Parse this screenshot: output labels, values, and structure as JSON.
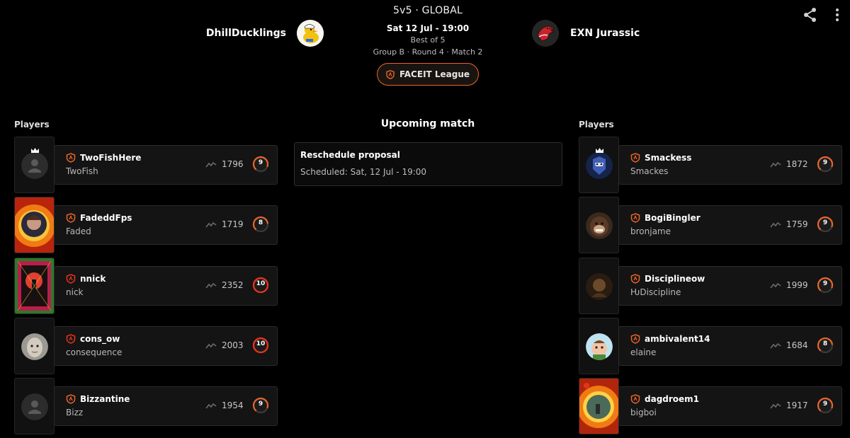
{
  "match": {
    "mode": "5v5 · GLOBAL",
    "datetime": "Sat 12 Jul - 19:00",
    "best_of": "Best of 5",
    "group_info": "Group B · Round 4 · Match 2",
    "league_label": "FACEIT League"
  },
  "team_left": {
    "name": "DhillDucklings",
    "players_label": "Players"
  },
  "team_right": {
    "name": "EXN Jurassic",
    "players_label": "Players"
  },
  "center": {
    "title": "Upcoming match",
    "proposal_title": "Reschedule proposal",
    "proposal_scheduled": "Scheduled: Sat, 12 Jul - 19:00"
  },
  "players_left": [
    {
      "nickname": "TwoFishHere",
      "name": "TwoFish",
      "elo": "1796",
      "level": "9",
      "captain": true,
      "avatar": "default-avatar"
    },
    {
      "nickname": "FadeddFps",
      "name": "Faded",
      "elo": "1719",
      "level": "8",
      "captain": false,
      "avatar": "explosion-portrait"
    },
    {
      "nickname": "nnick",
      "name": "nick",
      "elo": "2352",
      "level": "10",
      "captain": false,
      "avatar": "psychedelic-art"
    },
    {
      "nickname": "cons_ow",
      "name": "consequence",
      "elo": "2003",
      "level": "10",
      "captain": false,
      "avatar": "face-photo"
    },
    {
      "nickname": "Bizzantine",
      "name": "Bizz",
      "elo": "1954",
      "level": "9",
      "captain": false,
      "avatar": "default-avatar"
    }
  ],
  "players_right": [
    {
      "nickname": "Smackess",
      "name": "Smackes",
      "elo": "1872",
      "level": "9",
      "captain": true,
      "avatar": "armored-knight"
    },
    {
      "nickname": "BogiBingler",
      "name": "bronjame",
      "elo": "1759",
      "level": "9",
      "captain": false,
      "avatar": "gorilla"
    },
    {
      "nickname": "Disciplineow",
      "name": "ԊDiscipline",
      "elo": "1999",
      "level": "9",
      "captain": false,
      "avatar": "dark-figure"
    },
    {
      "nickname": "ambivalent14",
      "name": "elaine",
      "elo": "1684",
      "level": "8",
      "captain": false,
      "avatar": "cartoon-character"
    },
    {
      "nickname": "dagdroem1",
      "name": "bigboi",
      "elo": "1917",
      "level": "9",
      "captain": false,
      "avatar": "explosion-scene"
    }
  ],
  "colors": {
    "accent": "#e8642c",
    "level_10": "#e8331c",
    "background": "#000000",
    "card": "#141414"
  }
}
